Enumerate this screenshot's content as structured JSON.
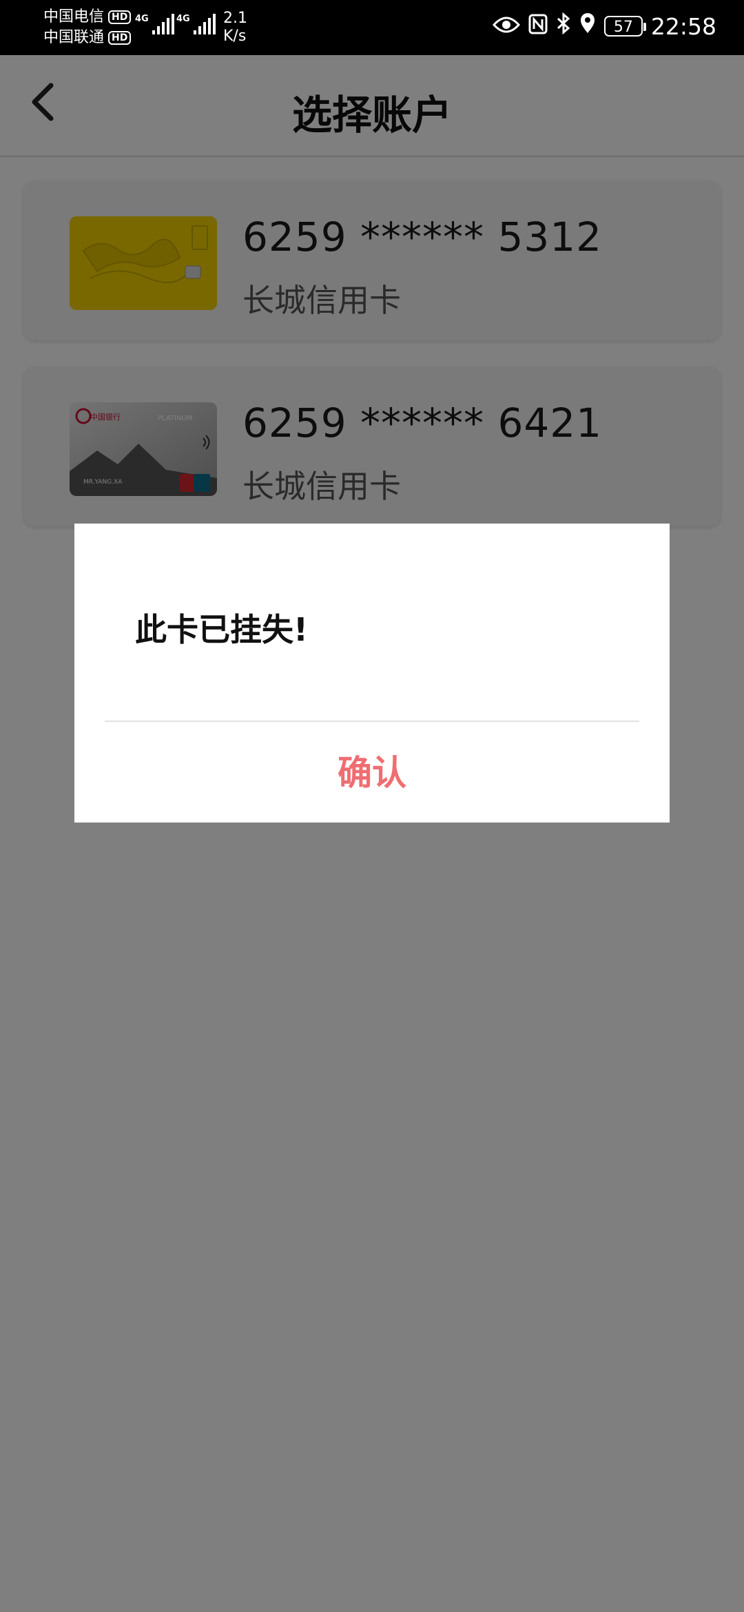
{
  "statusbar": {
    "carrier1": "中国电信",
    "carrier2": "中国联通",
    "hd": "HD",
    "network1": "4G",
    "network2": "4G",
    "speed_value": "2.1",
    "speed_unit": "K/s",
    "battery": "57",
    "time": "22:58",
    "icons": [
      "eye-icon",
      "nfc-icon",
      "bluetooth-icon",
      "location-icon",
      "battery-icon"
    ]
  },
  "header": {
    "back_icon": "chevron-left-icon",
    "title": "选择账户"
  },
  "cards": [
    {
      "number": "6259 ****** 5312",
      "type": "长城信用卡",
      "card_color": "#f2d000"
    },
    {
      "number": "6259 ****** 6421",
      "type": "长城信用卡",
      "card_color": "#c9c9c9"
    }
  ],
  "card2_face": {
    "bank_name": "中国银行",
    "platinum": "PLATINUM",
    "holder": "MR.YANG.XA"
  },
  "dialog": {
    "message": "此卡已挂失!",
    "confirm": "确认",
    "confirm_color": "#ef6d72"
  }
}
